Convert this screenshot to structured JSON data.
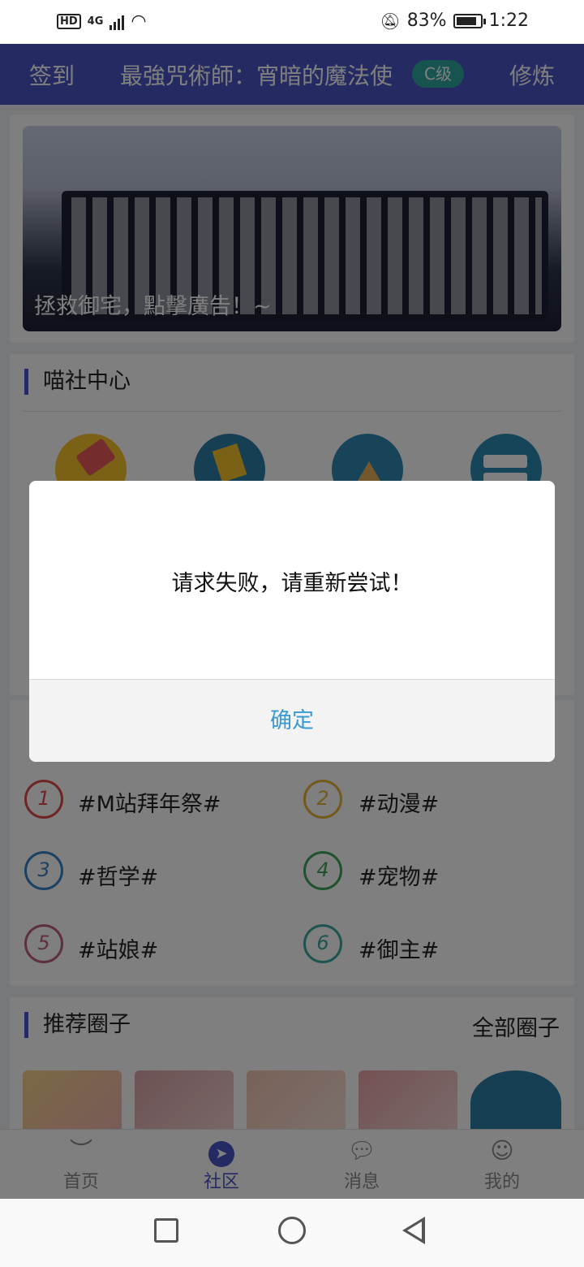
{
  "status_bar": {
    "network": "4G",
    "hd": "HD",
    "battery_percent": "83%",
    "time": "1:22",
    "battery_level": 0.83
  },
  "header": {
    "signin": "签到",
    "title": "最強咒術師：宵暗的魔法使",
    "rank": "C级",
    "train": "修炼"
  },
  "banner": {
    "caption": "拯救御宅，點擊廣告！~"
  },
  "center": {
    "title": "喵社中心",
    "icons": [
      "ticket-icon",
      "cards-icon",
      "mountain-icon",
      "signpost-icon"
    ]
  },
  "topics": {
    "items": [
      {
        "num": "1",
        "label": "#M站拜年祭#",
        "color": "#e04a4a"
      },
      {
        "num": "2",
        "label": "#动漫#",
        "color": "#e8b23a"
      },
      {
        "num": "3",
        "label": "#哲学#",
        "color": "#3b82c4"
      },
      {
        "num": "4",
        "label": "#宠物#",
        "color": "#3fa45a"
      },
      {
        "num": "5",
        "label": "#站娘#",
        "color": "#b8607a"
      },
      {
        "num": "6",
        "label": "#御主#",
        "color": "#3aa8a0"
      }
    ]
  },
  "circles": {
    "title": "推荐圈子",
    "more": "全部圈子"
  },
  "nav": {
    "home": "首页",
    "community": "社区",
    "messages": "消息",
    "mine": "我的"
  },
  "dialog": {
    "message": "请求失败，请重新尝试！",
    "confirm": "确定"
  },
  "colors": {
    "accent": "#4b57c4",
    "link": "#3a9ad4"
  }
}
